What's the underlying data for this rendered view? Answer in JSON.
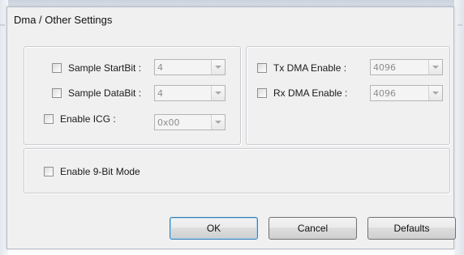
{
  "dialog": {
    "title": "Dma / Other Settings"
  },
  "left_group": {
    "sample_startbit": {
      "label": "Sample StartBit :",
      "value": "4"
    },
    "sample_databit": {
      "label": "Sample DataBit :",
      "value": "4"
    },
    "enable_icg": {
      "label": "Enable ICG :",
      "value": "0x00"
    }
  },
  "right_group": {
    "tx_dma": {
      "label": "Tx DMA Enable :",
      "value": "4096"
    },
    "rx_dma": {
      "label": "Rx DMA Enable :",
      "value": "4096"
    }
  },
  "bottom_group": {
    "enable_9bit": {
      "label": "Enable 9-Bit Mode"
    }
  },
  "buttons": {
    "ok": "OK",
    "cancel": "Cancel",
    "defaults": "Defaults"
  },
  "icons": {
    "combo_arrow": "chevron-down-icon"
  },
  "colors": {
    "dialog_bg": "#f0f0f0",
    "default_button_border": "#3c7fb1",
    "disabled_text": "#8d8d8d"
  }
}
